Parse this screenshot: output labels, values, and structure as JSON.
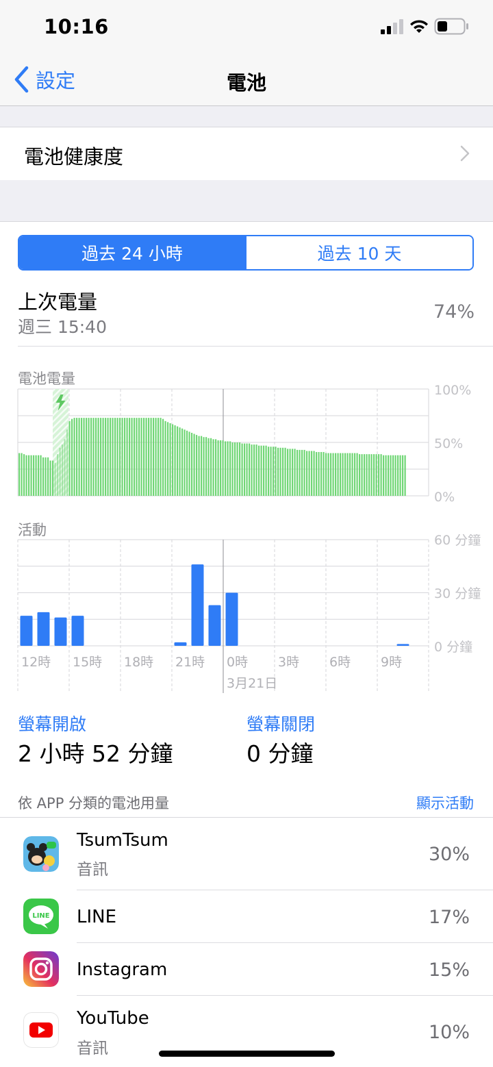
{
  "status": {
    "time": "10:16"
  },
  "nav": {
    "back_label": "設定",
    "title": "電池"
  },
  "battery_health": {
    "label": "電池健康度"
  },
  "segmented": {
    "tab1": "過去 24 小時",
    "tab2": "過去 10 天",
    "selected": "過去 24 小時"
  },
  "last_charge": {
    "title": "上次電量",
    "time": "週三 15:40",
    "percent": "74%"
  },
  "battery_chart": {
    "label": "電池電量",
    "y_ticks": [
      "100%",
      "50%",
      "0%"
    ]
  },
  "activity_chart": {
    "label": "活動",
    "y_ticks": [
      "60 分鐘",
      "30 分鐘",
      "0 分鐘"
    ],
    "x_ticks": [
      "12時",
      "15時",
      "18時",
      "21時",
      "0時",
      "3時",
      "6時",
      "9時"
    ],
    "date_label": "3月21日"
  },
  "chart_data": [
    {
      "type": "bar",
      "title": "電池電量",
      "ylim": [
        0,
        100
      ],
      "charging_segment": [
        2,
        3
      ],
      "values": [
        40,
        40,
        39,
        38,
        38,
        38,
        38,
        38,
        38,
        38,
        36,
        36,
        36,
        33,
        33,
        31,
        39,
        45,
        48,
        53,
        62,
        70,
        72,
        73,
        73,
        73,
        73,
        73,
        73,
        73,
        73,
        73,
        73,
        73,
        73,
        73,
        73,
        73,
        73,
        73,
        73,
        73,
        73,
        73,
        73,
        73,
        73,
        73,
        73,
        73,
        73,
        73,
        73,
        73,
        73,
        73,
        73,
        73,
        73,
        73,
        72,
        70,
        69,
        68,
        67,
        66,
        65,
        64,
        63,
        62,
        61,
        60,
        59,
        58,
        57,
        56,
        56,
        55,
        55,
        54,
        54,
        53,
        53,
        52,
        52,
        52,
        51,
        51,
        51,
        50,
        50,
        50,
        50,
        49,
        49,
        49,
        49,
        48,
        48,
        48,
        47,
        47,
        47,
        47,
        46,
        46,
        46,
        46,
        45,
        45,
        45,
        45,
        44,
        44,
        44,
        44,
        43,
        43,
        43,
        43,
        42,
        42,
        42,
        42,
        41,
        41,
        41,
        41,
        40,
        40,
        40,
        40,
        40,
        40,
        40,
        40,
        40,
        40,
        40,
        40,
        40,
        40,
        39,
        39,
        39,
        39,
        39,
        39,
        39,
        39,
        39,
        39,
        38,
        38,
        38,
        38,
        38,
        38,
        38,
        38,
        38,
        38
      ]
    },
    {
      "type": "bar",
      "title": "活動",
      "ylim": [
        0,
        60
      ],
      "unit": "分鐘",
      "categories": [
        "12時",
        "",
        "",
        "15時",
        "",
        "",
        "18時",
        "",
        "",
        "21時",
        "",
        "",
        "0時",
        "",
        "",
        "3時",
        "",
        "",
        "6時",
        "",
        "",
        "9時",
        "",
        ""
      ],
      "values": [
        17,
        19,
        16,
        17,
        0,
        0,
        0,
        0,
        0,
        2,
        46,
        23,
        30,
        0,
        0,
        0,
        0,
        0,
        0,
        0,
        0,
        0,
        1,
        0
      ]
    }
  ],
  "screen_time": {
    "on_label": "螢幕開啟",
    "on_value": "2 小時 52 分鐘",
    "off_label": "螢幕關閉",
    "off_value": "0 分鐘"
  },
  "by_app": {
    "label": "依 APP 分類的電池用量",
    "action": "顯示活動"
  },
  "apps": [
    {
      "name": "TsumTsum",
      "sub": "音訊",
      "percent": "30%"
    },
    {
      "name": "LINE",
      "sub": "",
      "percent": "17%"
    },
    {
      "name": "Instagram",
      "sub": "",
      "percent": "15%"
    },
    {
      "name": "YouTube",
      "sub": "音訊",
      "percent": "10%"
    }
  ],
  "colors": {
    "accent": "#2f7cf6",
    "battery_green": "#6fd674",
    "activity_blue": "#2f7cf6"
  }
}
